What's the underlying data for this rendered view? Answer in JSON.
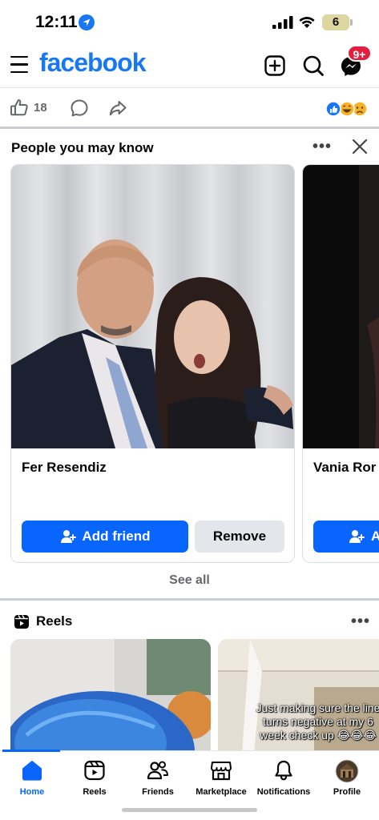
{
  "status_bar": {
    "time": "12:11",
    "battery": "6"
  },
  "header": {
    "logo": "facebook",
    "notification_badge": "9+"
  },
  "post_actions": {
    "like_count": "18"
  },
  "pymk": {
    "title": "People you may know",
    "cards": [
      {
        "name": "Fer Resendiz",
        "add_label": "Add friend",
        "remove_label": "Remove"
      },
      {
        "name": "Vania Ror",
        "add_label": "A"
      }
    ],
    "see_all": "See all"
  },
  "reels": {
    "title": "Reels",
    "items": [
      {
        "caption": ""
      },
      {
        "caption": "Just making sure the line turns negative at my 6 week check up 😂😂😂"
      }
    ]
  },
  "tabbar": {
    "tabs": [
      {
        "label": "Home",
        "icon": "home-icon",
        "active": true
      },
      {
        "label": "Reels",
        "icon": "reels-icon"
      },
      {
        "label": "Friends",
        "icon": "friends-icon"
      },
      {
        "label": "Marketplace",
        "icon": "marketplace-icon"
      },
      {
        "label": "Notifications",
        "icon": "bell-icon"
      },
      {
        "label": "Profile",
        "icon": "profile-avatar"
      }
    ]
  },
  "colors": {
    "brand": "#1877f2",
    "button": "#0866ff",
    "badge": "#e41e3f"
  }
}
